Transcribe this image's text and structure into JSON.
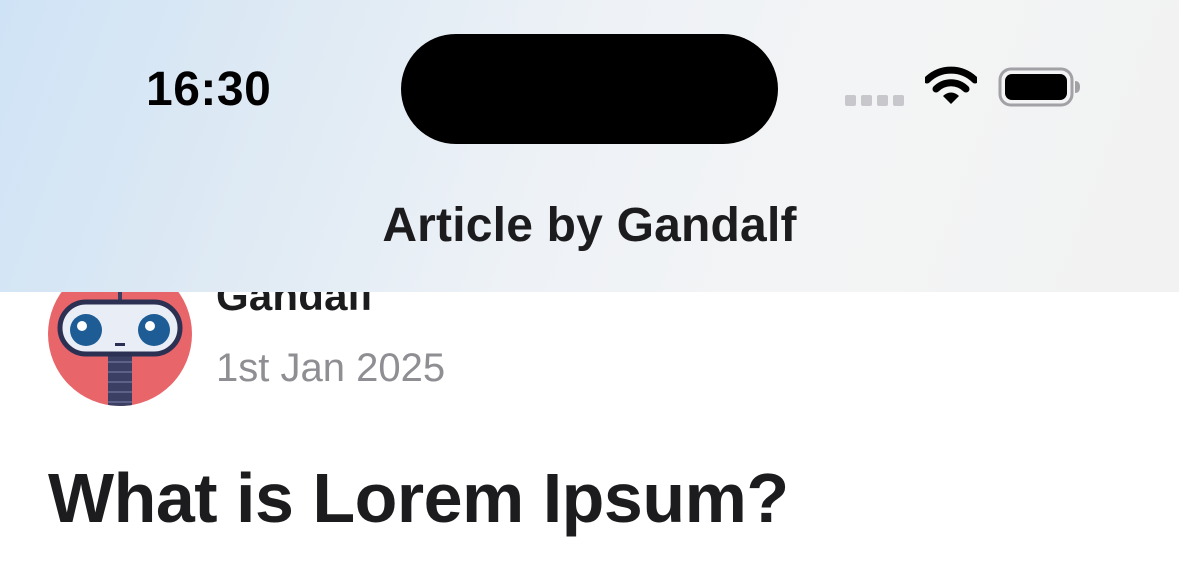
{
  "status_bar": {
    "time": "16:30",
    "icons": [
      "signal-dots-icon",
      "wifi-icon",
      "battery-icon"
    ]
  },
  "nav": {
    "title": "Article by Gandalf"
  },
  "author": {
    "name": "Gandalf",
    "date": "1st Jan 2025",
    "avatar_icon": "robot-avatar-icon"
  },
  "article": {
    "title": "What is Lorem Ipsum?"
  },
  "colors": {
    "avatar_background": "#e8666a",
    "primary_text": "#1c1c1e",
    "secondary_text": "#8e8e93"
  }
}
